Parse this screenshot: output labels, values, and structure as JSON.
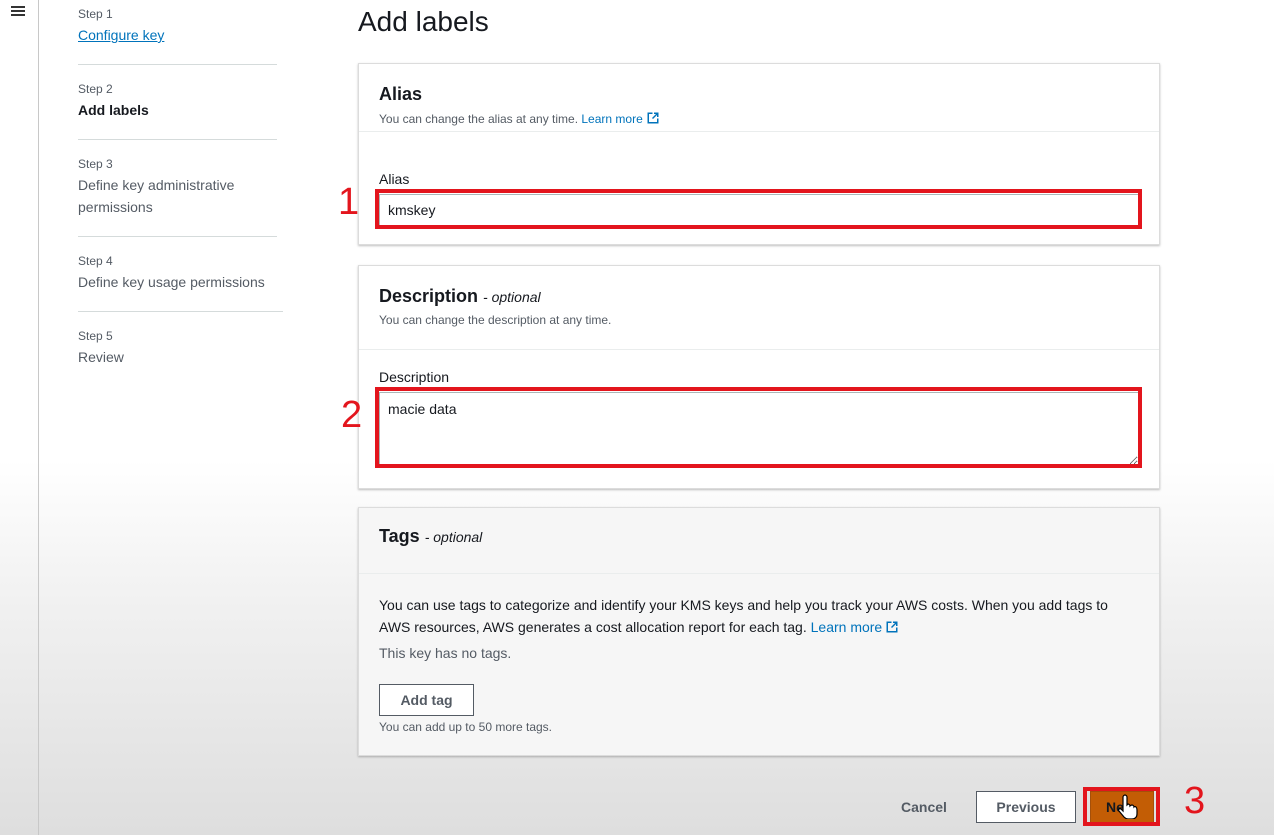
{
  "steps": [
    {
      "num": "Step 1",
      "title": "Configure key"
    },
    {
      "num": "Step 2",
      "title": "Add labels"
    },
    {
      "num": "Step 3",
      "title": "Define key administrative permissions"
    },
    {
      "num": "Step 4",
      "title": "Define key usage permissions"
    },
    {
      "num": "Step 5",
      "title": "Review"
    }
  ],
  "page_title": "Add labels",
  "alias": {
    "heading": "Alias",
    "sub": "You can change the alias at any time.",
    "learn_more": "Learn more",
    "field_label": "Alias",
    "value": "kmskey"
  },
  "description": {
    "heading": "Description",
    "optional": "- optional",
    "sub": "You can change the description at any time.",
    "field_label": "Description",
    "value": "macie data"
  },
  "tags": {
    "heading": "Tags",
    "optional": "- optional",
    "body": "You can use tags to categorize and identify your KMS keys and help you track your AWS costs. When you add tags to AWS resources, AWS generates a cost allocation report for each tag.",
    "learn_more": "Learn more",
    "empty": "This key has no tags.",
    "add_tag": "Add tag",
    "limit": "You can add up to 50 more tags."
  },
  "actions": {
    "cancel": "Cancel",
    "previous": "Previous",
    "next": "Ne"
  },
  "annotations": [
    "1",
    "2",
    "3"
  ],
  "colors": {
    "highlight": "#e3151d",
    "link": "#0073bb",
    "primary": "#c35d05"
  }
}
